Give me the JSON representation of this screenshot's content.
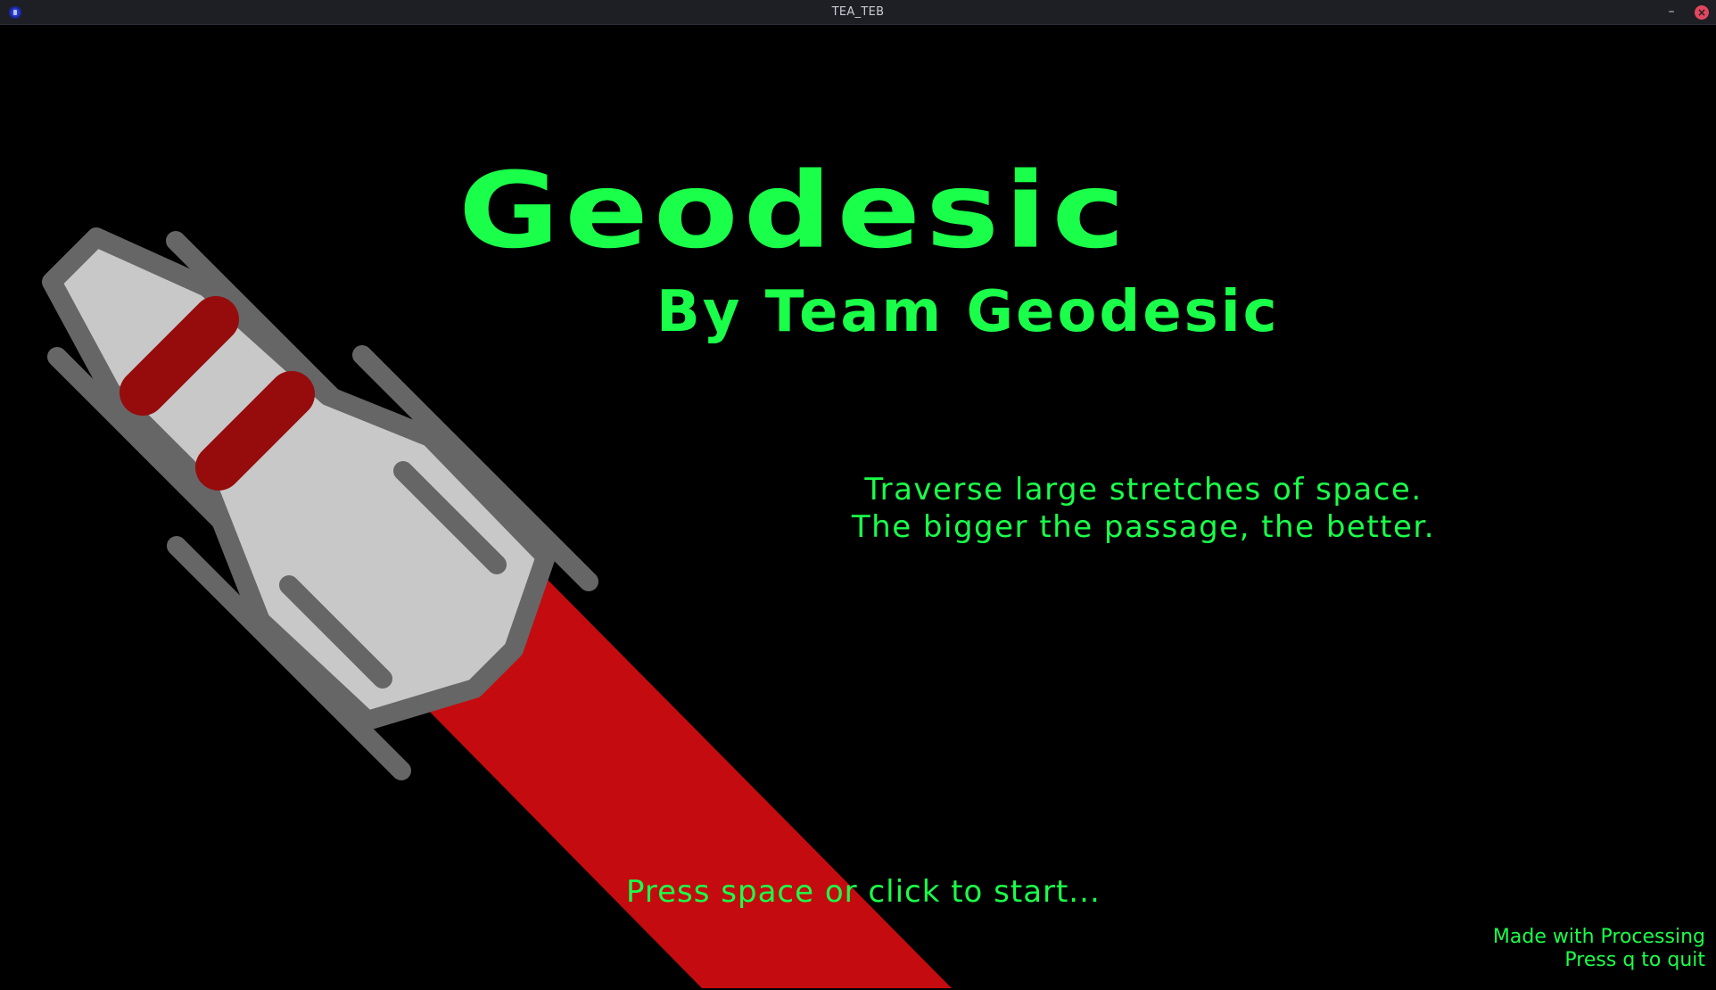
{
  "window": {
    "title": "TEA_TEB"
  },
  "titlebar": {
    "minimize_symbol": "–",
    "close_symbol": "×",
    "app_icon": "app-icon",
    "minimize_icon": "minimize-icon",
    "close_icon": "close-icon"
  },
  "game": {
    "title": "Geodesic",
    "subtitle": "By Team Geodesic",
    "tagline": [
      "Traverse large stretches of space.",
      "The bigger the passage, the better."
    ],
    "start_prompt": "Press space or click to start...",
    "credits": [
      "Made with Processing",
      "Press q to quit"
    ]
  },
  "colors": {
    "background": "#000000",
    "text_green": "#1aff4a",
    "ship_body": "#c8c8c8",
    "ship_outline": "#666666",
    "ship_stripes": "#960c0c",
    "exhaust_trail": "#c40c10",
    "titlebar": "#1d1f24",
    "close_button": "#e2465e"
  }
}
